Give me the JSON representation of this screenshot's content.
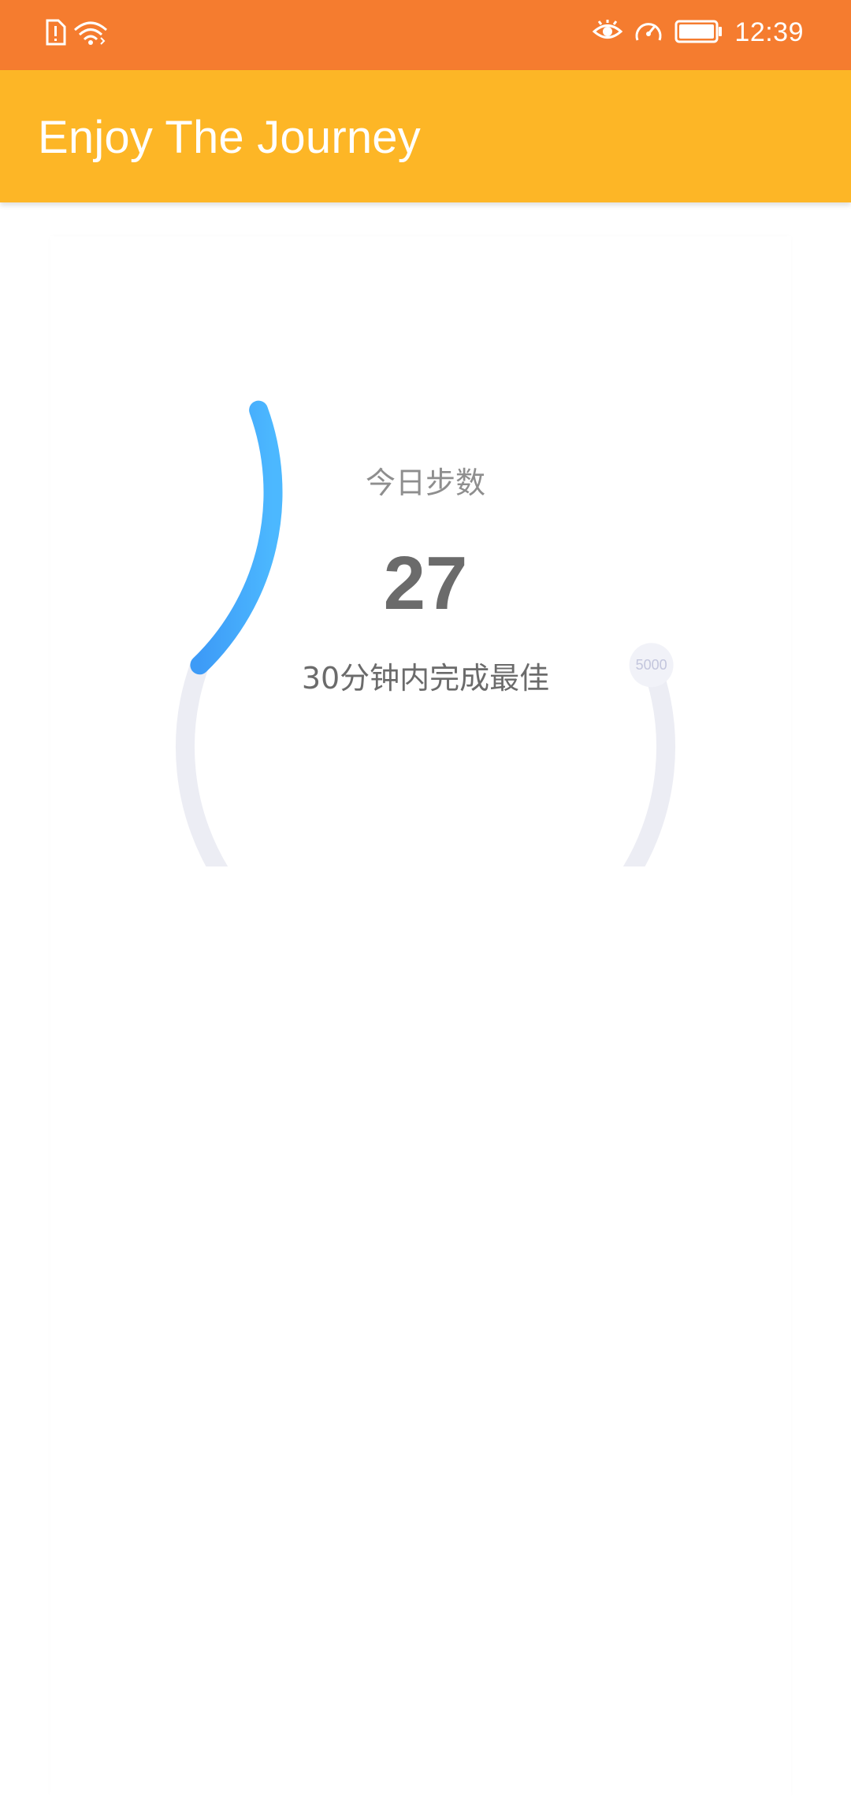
{
  "status_bar": {
    "time": "12:39",
    "left_icons": [
      "sim-alert-icon",
      "wifi-icon"
    ],
    "right_icons": [
      "eye-icon",
      "speed-icon",
      "battery-icon"
    ],
    "bg_color": "#f57c2f"
  },
  "app_bar": {
    "title": "Enjoy The Journey",
    "bg_color": "#fdb626"
  },
  "step_gauge": {
    "label": "今日步数",
    "value": "27",
    "hint": "30分钟内完成最佳",
    "goal_label": "5000",
    "progress_fraction": 0.3,
    "track_color": "#ecedf4",
    "progress_color_start": "#3d9bf7",
    "progress_color_end": "#4cb8ff"
  }
}
